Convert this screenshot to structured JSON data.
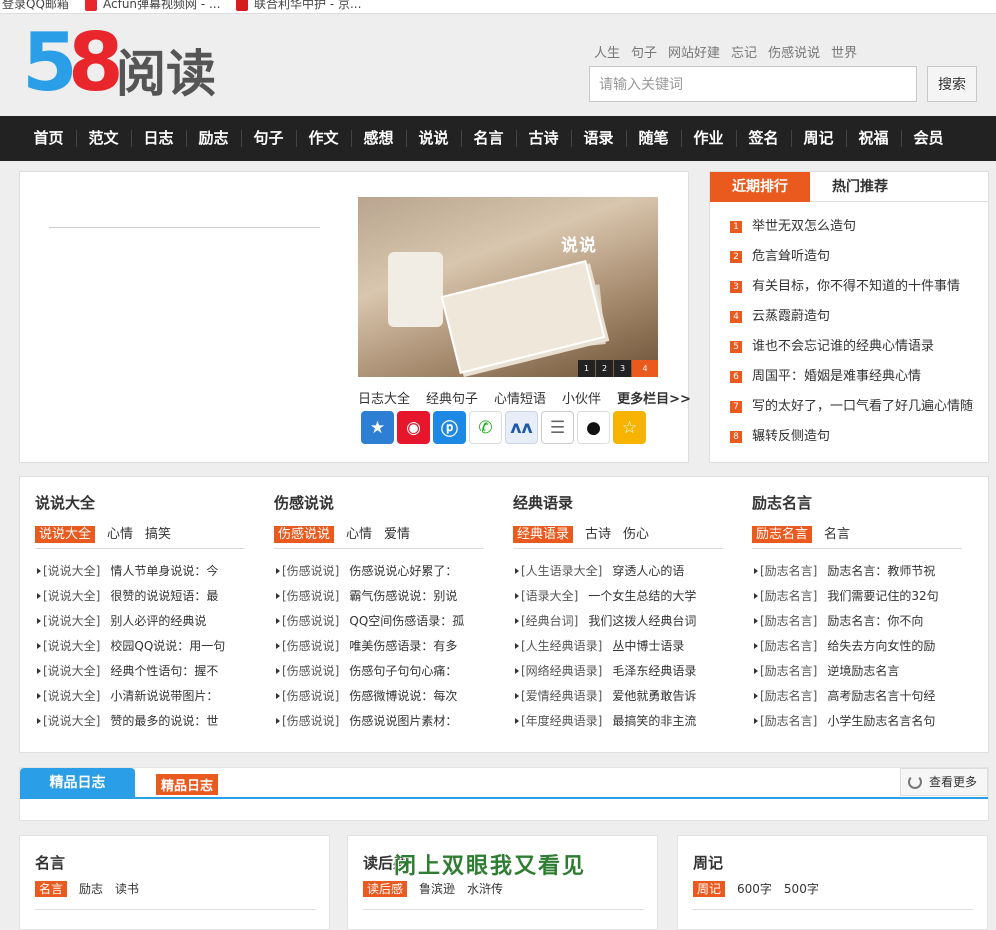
{
  "bookmarks": [
    {
      "label": "登录QQ邮箱",
      "icon": "mail-icon",
      "color": "#2b9ee8"
    },
    {
      "label": "Acfun弹幕视频网 - ...",
      "icon": "acfun-icon",
      "color": "#e8262b"
    },
    {
      "label": "联合利华中护 - 京...",
      "icon": "jd-icon",
      "color": "#d71c1e"
    }
  ],
  "logo": {
    "digit5": "5",
    "digit8": "8",
    "text": "阅读"
  },
  "hotwords": [
    "人生",
    "句子",
    "网站好建",
    "忘记",
    "伤感说说",
    "世界"
  ],
  "search": {
    "placeholder": "请输入关键词",
    "button": "搜索"
  },
  "nav": [
    "首页",
    "范文",
    "日志",
    "励志",
    "句子",
    "作文",
    "感想",
    "说说",
    "名言",
    "古诗",
    "语录",
    "随笔",
    "作业",
    "签名",
    "周记",
    "祝福",
    "会员"
  ],
  "slider": {
    "caption": "说说",
    "pages": [
      "1",
      "2",
      "3",
      "4"
    ],
    "active_page": 4
  },
  "quicklinks": [
    "日志大全",
    "经典句子",
    "心情短语",
    "小伙伴"
  ],
  "more_columns": "更多栏目>>",
  "share_icons": [
    "qzone-icon",
    "weibo-icon",
    "pengyou-icon",
    "wechat-icon",
    "renren-icon",
    "notes-icon",
    "qq-icon",
    "favorite-icon"
  ],
  "rank_tabs": [
    "近期排行",
    "热门推荐"
  ],
  "rank_items": [
    "举世无双怎么造句",
    "危言耸听造句",
    "有关目标，你不得不知道的十件事情",
    "云蒸霞蔚造句",
    "谁也不会忘记谁的经典心情语录",
    "周国平：婚姻是难事经典心情",
    "写的太好了，一口气看了好几遍心情随笔",
    "辗转反侧造句"
  ],
  "columns": [
    {
      "title": "说说大全",
      "tags": [
        "说说大全",
        "心情",
        "搞笑"
      ],
      "items": [
        {
          "cat": "[说说大全]",
          "text": "情人节单身说说：今"
        },
        {
          "cat": "[说说大全]",
          "text": "很赞的说说短语：最"
        },
        {
          "cat": "[说说大全]",
          "text": "别人必评的经典说"
        },
        {
          "cat": "[说说大全]",
          "text": "校园QQ说说：用一句"
        },
        {
          "cat": "[说说大全]",
          "text": "经典个性语句：握不"
        },
        {
          "cat": "[说说大全]",
          "text": "小清新说说带图片："
        },
        {
          "cat": "[说说大全]",
          "text": "赞的最多的说说：世"
        }
      ]
    },
    {
      "title": "伤感说说",
      "tags": [
        "伤感说说",
        "心情",
        "爱情"
      ],
      "items": [
        {
          "cat": "[伤感说说]",
          "text": "伤感说说心好累了："
        },
        {
          "cat": "[伤感说说]",
          "text": "霸气伤感说说：别说"
        },
        {
          "cat": "[伤感说说]",
          "text": "QQ空间伤感语录：孤"
        },
        {
          "cat": "[伤感说说]",
          "text": "唯美伤感语录：有多"
        },
        {
          "cat": "[伤感说说]",
          "text": "伤感句子句句心痛："
        },
        {
          "cat": "[伤感说说]",
          "text": "伤感微博说说：每次"
        },
        {
          "cat": "[伤感说说]",
          "text": "伤感说说图片素材："
        }
      ]
    },
    {
      "title": "经典语录",
      "tags": [
        "经典语录",
        "古诗",
        "伤心"
      ],
      "items": [
        {
          "cat": "[人生语录大全]",
          "text": "穿透人心的语"
        },
        {
          "cat": "[语录大全]",
          "text": "一个女生总结的大学"
        },
        {
          "cat": "[经典台词]",
          "text": "我们这拨人经典台词"
        },
        {
          "cat": "[人生经典语录]",
          "text": "丛中博士语录"
        },
        {
          "cat": "[网络经典语录]",
          "text": "毛泽东经典语录"
        },
        {
          "cat": "[爱情经典语录]",
          "text": "爱他就勇敢告诉"
        },
        {
          "cat": "[年度经典语录]",
          "text": "最搞笑的非主流"
        }
      ]
    },
    {
      "title": "励志名言",
      "tags": [
        "励志名言",
        "名言"
      ],
      "items": [
        {
          "cat": "[励志名言]",
          "text": "励志名言：教师节祝"
        },
        {
          "cat": "[励志名言]",
          "text": "我们需要记住的32句"
        },
        {
          "cat": "[励志名言]",
          "text": "励志名言：你不向"
        },
        {
          "cat": "[励志名言]",
          "text": "给失去方向女性的励"
        },
        {
          "cat": "[励志名言]",
          "text": "逆境励志名言"
        },
        {
          "cat": "[励志名言]",
          "text": "高考励志名言十句经"
        },
        {
          "cat": "[励志名言]",
          "text": "小学生励志名言名句"
        }
      ]
    }
  ],
  "section": {
    "tab": "精品日志",
    "tag": "精品日志",
    "more": "查看更多"
  },
  "cards": [
    {
      "title": "名言",
      "tags": [
        "名言",
        "励志",
        "读书"
      ]
    },
    {
      "title": "读后感",
      "tags": [
        "读后感",
        "鲁滨逊",
        "水浒传"
      ]
    },
    {
      "title": "周记",
      "tags": [
        "周记",
        "600字",
        "500字"
      ]
    }
  ],
  "overlay": "闭上双眼我又看见",
  "colors": {
    "accent": "#ea5a1f",
    "blue": "#2b9ee8",
    "nav_bg": "#222222"
  }
}
